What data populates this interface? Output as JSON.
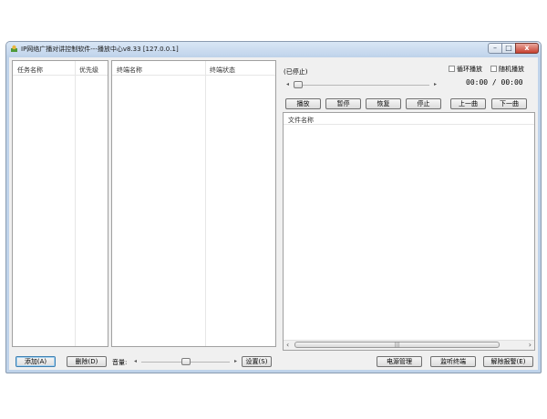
{
  "window": {
    "title": "IP网络广播对讲控制软件---播放中心v8.33  [127.0.0.1]",
    "minimize": "–",
    "maximize": "□",
    "close": "x"
  },
  "task_list": {
    "col_name": "任务名称",
    "col_priority": "优先级"
  },
  "terminal_list": {
    "col_name": "终端名称",
    "col_status": "终端状态"
  },
  "player": {
    "status": "(已停止)",
    "time": "00:00 / 00:00",
    "loop_label": "循环播放",
    "random_label": "随机播放",
    "progress": 0,
    "buttons": {
      "play": "播放",
      "pause": "暂停",
      "resume": "恢复",
      "stop": "停止",
      "prev": "上一曲",
      "next": "下一曲"
    }
  },
  "file_list": {
    "col_name": "文件名称",
    "scroll_left": "‹",
    "scroll_right": "›",
    "grip": "|||"
  },
  "bottom": {
    "add": "添加(A)",
    "delete": "删除(D)",
    "volume_label": "音量:",
    "volume": 0.5,
    "settings": "设置(S)",
    "power": "电源管理",
    "monitor": "监听终端",
    "release": "解除报警(E)"
  },
  "arrows": {
    "left": "◂",
    "right": "▸"
  },
  "colors": {
    "title_bar": "#c2d5ec",
    "panel": "#ffffff",
    "client": "#f0f0f0",
    "close_button": "#c7402f"
  }
}
